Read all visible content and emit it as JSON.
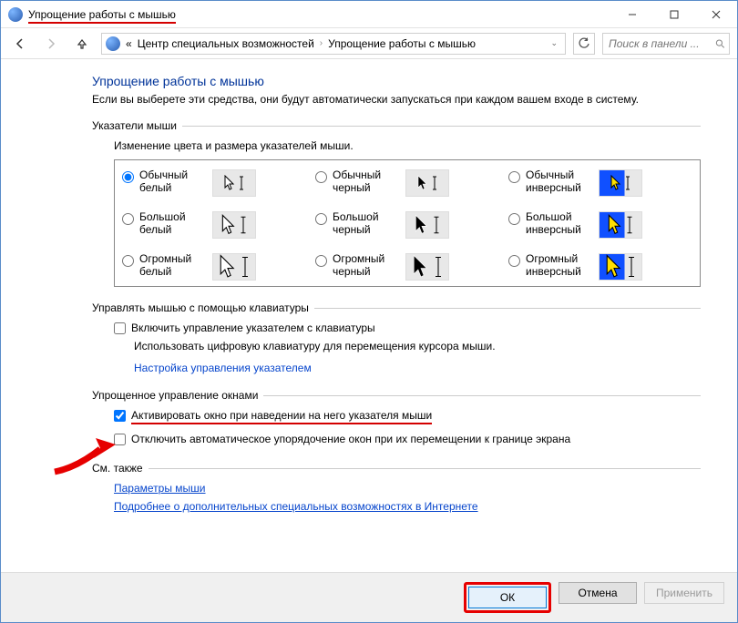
{
  "window": {
    "title": "Упрощение работы с мышью"
  },
  "nav": {
    "crumb0": "«",
    "crumb1": "Центр специальных возможностей",
    "crumb2": "Упрощение работы с мышью"
  },
  "search": {
    "placeholder": "Поиск в панели ..."
  },
  "page": {
    "title": "Упрощение работы с мышью",
    "desc": "Если вы выберете эти средства, они будут автоматически запускаться при каждом вашем входе в систему."
  },
  "pointers": {
    "group": "Указатели мыши",
    "desc": "Изменение цвета и размера указателей мыши.",
    "opts": [
      "Обычный белый",
      "Обычный черный",
      "Обычный инверсный",
      "Большой белый",
      "Большой черный",
      "Большой инверсный",
      "Огромный белый",
      "Огромный черный",
      "Огромный инверсный"
    ]
  },
  "keyboard": {
    "group": "Управлять мышью с помощью клавиатуры",
    "check": "Включить управление указателем с клавиатуры",
    "desc": "Использовать цифровую клавиатуру для перемещения курсора мыши.",
    "link": "Настройка управления указателем"
  },
  "windows": {
    "group": "Упрощенное управление окнами",
    "check1": "Активировать окно при наведении на него указателя мыши",
    "check2": "Отключить автоматическое упорядочение окон при их перемещении к границе экрана"
  },
  "seealso": {
    "group": "См. также",
    "link1": "Параметры мыши",
    "link2": "Подробнее о дополнительных специальных возможностях в Интернете"
  },
  "buttons": {
    "ok": "ОК",
    "cancel": "Отмена",
    "apply": "Применить"
  }
}
